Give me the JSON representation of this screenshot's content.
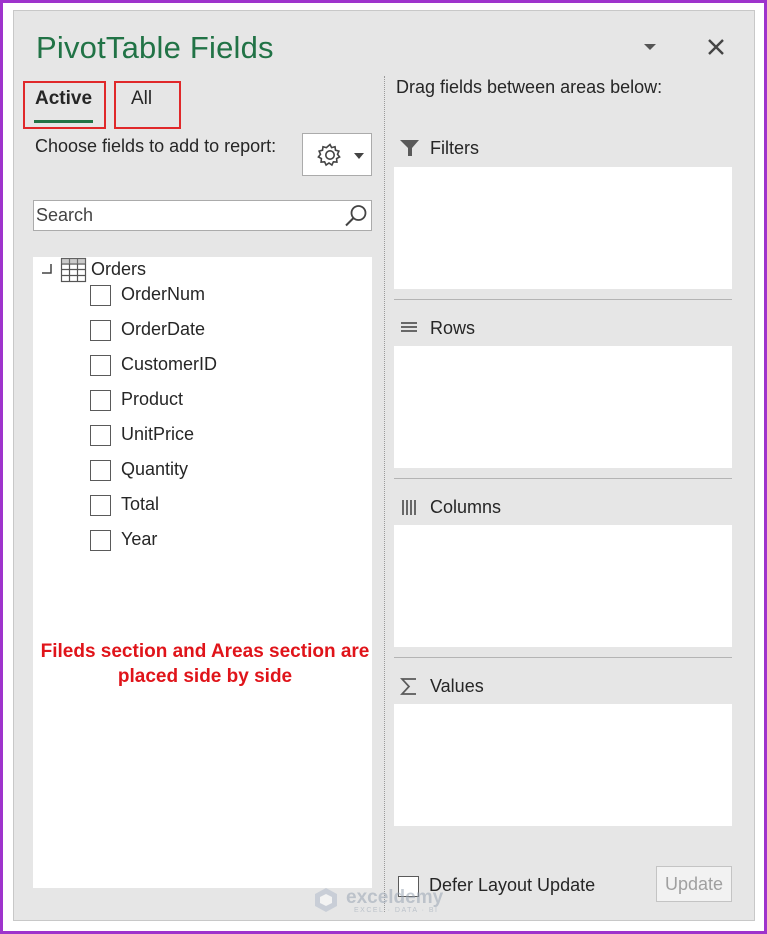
{
  "pane": {
    "title": "PivotTable Fields",
    "tabs": [
      {
        "label": "Active"
      },
      {
        "label": "All"
      }
    ]
  },
  "fields_section": {
    "choose_label": "Choose fields to add to report:",
    "search_placeholder": "Search",
    "table_name": "Orders",
    "fields": [
      {
        "label": "OrderNum",
        "checked": false
      },
      {
        "label": "OrderDate",
        "checked": false
      },
      {
        "label": "CustomerID",
        "checked": false
      },
      {
        "label": "Product",
        "checked": false
      },
      {
        "label": "UnitPrice",
        "checked": false
      },
      {
        "label": "Quantity",
        "checked": false
      },
      {
        "label": "Total",
        "checked": false
      },
      {
        "label": "Year",
        "checked": false
      }
    ]
  },
  "annotation": {
    "text": "Fileds section and Areas section are placed side by side",
    "color": "#e0141a"
  },
  "areas_section": {
    "drag_label": "Drag fields between areas below:",
    "areas": [
      {
        "label": "Filters",
        "icon": "filter-icon"
      },
      {
        "label": "Rows",
        "icon": "rows-icon"
      },
      {
        "label": "Columns",
        "icon": "columns-icon"
      },
      {
        "label": "Values",
        "icon": "sigma-icon"
      }
    ]
  },
  "footer": {
    "defer_label": "Defer Layout Update",
    "defer_checked": false,
    "update_label": "Update"
  },
  "watermark": {
    "name": "exceldemy",
    "tagline": "EXCEL · DATA · BI"
  },
  "colors": {
    "accent": "#217346",
    "highlight_box": "#e0282a",
    "frame": "#9e33cc"
  }
}
